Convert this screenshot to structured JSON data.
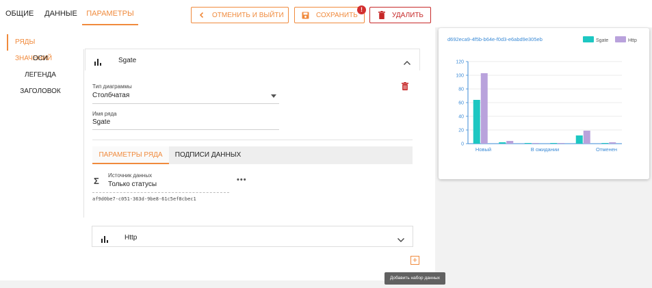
{
  "tabs": [
    {
      "label": "ОБЩИЕ"
    },
    {
      "label": "ДАННЫЕ"
    },
    {
      "label": "ПАРАМЕТРЫ"
    }
  ],
  "toolbar": {
    "cancel_label": "ОТМЕНИТЬ И ВЫЙТИ",
    "save_label": "СОХРАНИТЬ",
    "save_badge": "!",
    "delete_label": "УДАЛИТЬ"
  },
  "sidebar": {
    "items": [
      {
        "label": "РЯДЫ ЗНАЧЕНИЙ"
      },
      {
        "label": "ОСИ"
      },
      {
        "label": "ЛЕГЕНДА"
      },
      {
        "label": "ЗАГОЛОВОК"
      }
    ]
  },
  "series1": {
    "title": "Sgate",
    "type_label": "Тип диаграммы",
    "type_value": "Столбчатая",
    "name_label": "Имя ряда",
    "name_value": "Sgate",
    "subtabs": [
      "ПАРАМЕТРЫ РЯДА",
      "ПОДПИСИ ДАННЫХ"
    ],
    "source_label": "Источник данных",
    "source_value": "Только статусы",
    "source_id": "af9d0be7-c051-363d-9be8-61c5ef8cbec1"
  },
  "series2": {
    "title": "Http"
  },
  "add_tooltip": "Добавить набор данных",
  "colors": {
    "accent": "#f08a3c",
    "danger": "#c62828",
    "sgate": "#1dc7c2",
    "http": "#b9a2dc"
  },
  "chart_data": {
    "type": "bar",
    "title": "d692eca9-4f5b-b64e-f0d3-e6abd9e305eb",
    "legend_position": "top-right",
    "categories": [
      "Новый",
      "В ожидании",
      "Отменен"
    ],
    "category_labels": [
      "Новый",
      "",
      "В ожидании",
      "",
      "Отменен"
    ],
    "series": [
      {
        "name": "Sgate",
        "values": [
          64,
          2,
          1,
          1,
          12,
          1
        ]
      },
      {
        "name": "Http",
        "values": [
          103,
          4,
          1,
          1,
          19,
          2
        ]
      }
    ],
    "ylim": [
      0,
      120
    ],
    "yticks": [
      "0",
      "20",
      "40",
      "60",
      "80",
      "100",
      "120"
    ],
    "grid": true
  }
}
